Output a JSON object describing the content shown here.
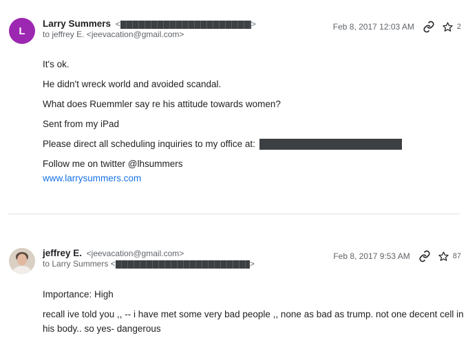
{
  "messages": [
    {
      "avatar_letter": "L",
      "avatar_color": "#9c27b0",
      "sender_name": "Larry Summers",
      "sender_email_open": "<",
      "sender_email_close": ">",
      "recipient": "to jeffrey E. <jeevacation@gmail.com>",
      "date": "Feb 8, 2017 12:03 AM",
      "star_count": "2",
      "body": {
        "line1": "It's ok.",
        "line2": "He didn't wreck world and avoided scandal.",
        "line3": "What does Ruemmler say re his attitude towards women?",
        "line4": "Sent from my iPad",
        "line5": "Please direct all scheduling inquiries to my office at:",
        "line6": "Follow me on twitter @lhsummers",
        "link": "www.larrysummers.com"
      }
    },
    {
      "sender_name": "jeffrey E.",
      "sender_email": "<jeevacation@gmail.com>",
      "recipient_prefix": "to Larry Summers <",
      "recipient_suffix": ">",
      "date": "Feb 8, 2017 9:53 AM",
      "star_count": "87",
      "body": {
        "line1": "Importance: High",
        "line2": "recall ive told you ,, -- i have met some very bad people ,, none as bad as trump. not one decent cell in",
        "line3": "his body.. so yes- dangerous"
      }
    }
  ],
  "icons": {
    "link": "link-icon",
    "star": "star-outline-icon",
    "avatar_photo": "person-photo"
  }
}
